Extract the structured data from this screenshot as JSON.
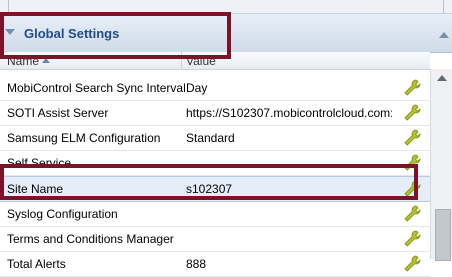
{
  "panel": {
    "title": "Global Settings"
  },
  "columns": {
    "name": "Name",
    "value": "Value"
  },
  "rows": [
    {
      "name": "MobiControl Search Sync Interval",
      "value": "Day"
    },
    {
      "name": "SOTI Assist Server",
      "value": "https://S102307.mobicontrolcloud.com:..."
    },
    {
      "name": "Samsung ELM Configuration",
      "value": "Standard"
    },
    {
      "name": "Self Service",
      "value": ""
    },
    {
      "name": "Site Name",
      "value": "s102307"
    },
    {
      "name": "Syslog Configuration",
      "value": ""
    },
    {
      "name": "Terms and Conditions Manager",
      "value": ""
    },
    {
      "name": "Total Alerts",
      "value": "888"
    }
  ],
  "selected_row": "Site Name",
  "icons": {
    "edit": "wrench-edit-icon",
    "collapse": "chevron-down-icon",
    "sort": "sort-ascending-icon"
  },
  "colors": {
    "title": "#1f4e86",
    "highlight": "#7b1428",
    "wrench": "#b5c42a"
  }
}
